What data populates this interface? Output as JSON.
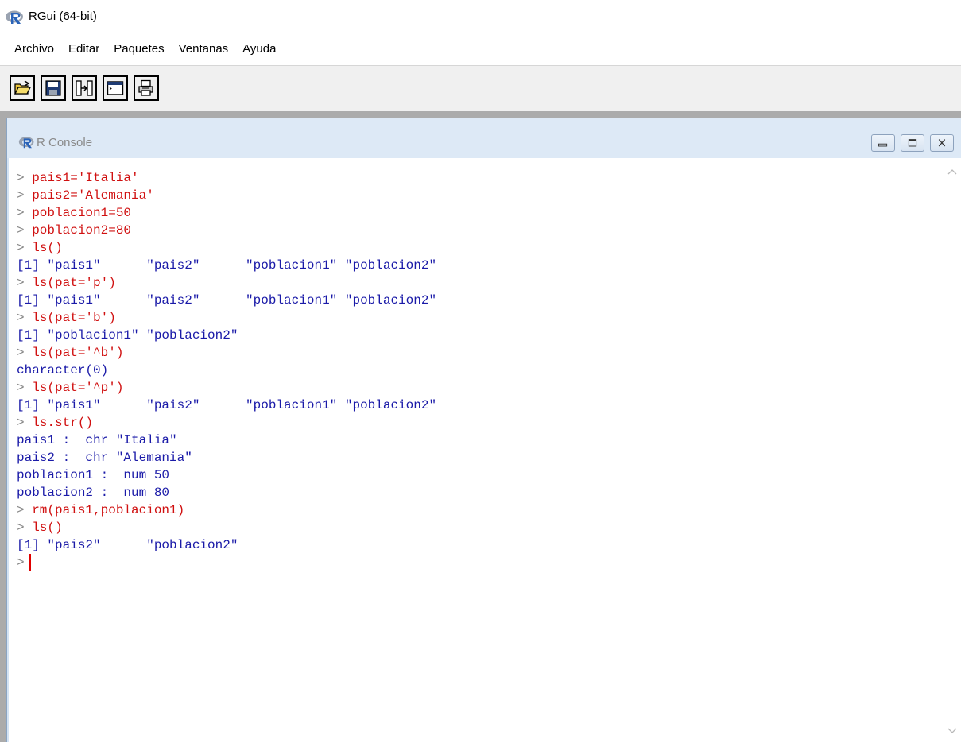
{
  "window": {
    "title": "RGui (64-bit)"
  },
  "menu": {
    "items": [
      {
        "id": "archivo",
        "label": "Archivo"
      },
      {
        "id": "editar",
        "label": "Editar"
      },
      {
        "id": "paquetes",
        "label": "Paquetes"
      },
      {
        "id": "ventanas",
        "label": "Ventanas"
      },
      {
        "id": "ayuda",
        "label": "Ayuda"
      }
    ]
  },
  "toolbar": {
    "buttons": [
      {
        "icon": "open-script-icon"
      },
      {
        "icon": "save-icon"
      },
      {
        "icon": "copy-paste-icon"
      },
      {
        "icon": "console-icon"
      },
      {
        "icon": "print-icon"
      }
    ]
  },
  "console": {
    "title": "R Console",
    "prompt_symbol": ">",
    "lines": [
      {
        "type": "cmd",
        "text": "pais1='Italia'"
      },
      {
        "type": "cmd",
        "text": "pais2='Alemania'"
      },
      {
        "type": "cmd",
        "text": "poblacion1=50"
      },
      {
        "type": "cmd",
        "text": "poblacion2=80"
      },
      {
        "type": "cmd",
        "text": "ls()"
      },
      {
        "type": "out",
        "text": "[1] \"pais1\"      \"pais2\"      \"poblacion1\" \"poblacion2\""
      },
      {
        "type": "cmd",
        "text": "ls(pat='p')"
      },
      {
        "type": "out",
        "text": "[1] \"pais1\"      \"pais2\"      \"poblacion1\" \"poblacion2\""
      },
      {
        "type": "cmd",
        "text": "ls(pat='b')"
      },
      {
        "type": "out",
        "text": "[1] \"poblacion1\" \"poblacion2\""
      },
      {
        "type": "cmd",
        "text": "ls(pat='^b')"
      },
      {
        "type": "out",
        "text": "character(0)"
      },
      {
        "type": "cmd",
        "text": "ls(pat='^p')"
      },
      {
        "type": "out",
        "text": "[1] \"pais1\"      \"pais2\"      \"poblacion1\" \"poblacion2\""
      },
      {
        "type": "cmd",
        "text": "ls.str()"
      },
      {
        "type": "out",
        "text": "pais1 :  chr \"Italia\""
      },
      {
        "type": "out",
        "text": "pais2 :  chr \"Alemania\""
      },
      {
        "type": "out",
        "text": "poblacion1 :  num 50"
      },
      {
        "type": "out",
        "text": "poblacion2 :  num 80"
      },
      {
        "type": "cmd",
        "text": "rm(pais1,poblacion1)"
      },
      {
        "type": "cmd",
        "text": "ls()"
      },
      {
        "type": "out",
        "text": "[1] \"pais2\"      \"poblacion2\""
      }
    ]
  },
  "colors": {
    "command": "#d01010",
    "output": "#1a1aa8",
    "cursor": "#e00000",
    "toolbar_bg": "#f0f0f0",
    "mdi_bg": "#ababab"
  }
}
